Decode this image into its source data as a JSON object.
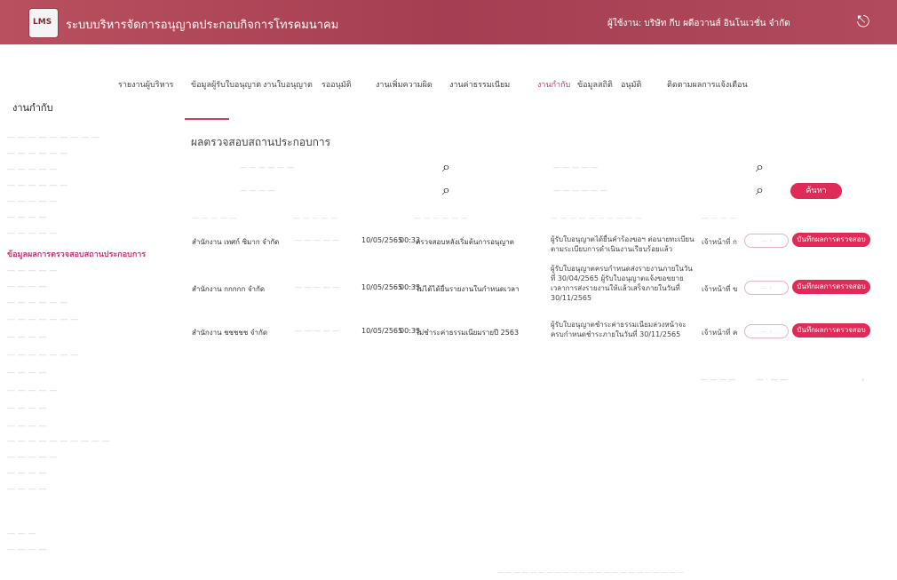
{
  "header": {
    "logo_text": "LMS",
    "app_title": "ระบบบริหารจัดการอนุญาตประกอบกิจการโทรคมนาคม",
    "user": "ผู้ใช้งาน: บริษัท กีบ ผดีอวานส์ อินโนเวชั่น จำกัด",
    "logout_icon": "logout-icon"
  },
  "nav": {
    "items": [
      "รายงานผู้บริหาร",
      "ข้อมูลผู้รับใบอนุญาต",
      "งานใบอนุญาต",
      "รออนุมัติ",
      "งานเพิ่มความผิด",
      "งานค่าธรรมเนียม",
      "งานกำกับ",
      "ข้อมูลสถิติ",
      "อนุมัติ",
      "ติดตามผลการแจ้งเตือน"
    ],
    "active": "งานกำกับ"
  },
  "sidebar": {
    "title": "งานกำกับ",
    "active_item": "ข้อมูลผลการตรวจสอบสถานประกอบการ"
  },
  "main": {
    "page_title": "ผลตรวจสอบสถานประกอบการ",
    "search_button": "ค้นหา",
    "rows": [
      {
        "company": "สำนักงาน เทศก์ ซิมาก จำกัด",
        "date": "10/05/2565",
        "time": "00:33",
        "topic": "ตรวจสอบหลังเริ่มต้นการอนุญาต",
        "notes": "ผู้รับใบอนุญาตได้ยื่นคำร้องขอฯ ต่อนายทะเบียนตามระเบียบการดำเนินงานเรียบร้อยแล้ว",
        "status": "เจ้าหน้าที่ ก",
        "action": "บันทึกผลการตรวจสอบ"
      },
      {
        "company": "สำนักงาน กกกกก จำกัด",
        "date": "10/05/2565",
        "time": "00:33",
        "topic": "ไม่ได้ได้ยื่นรายงานในกำหนดเวลา",
        "notes": "ผู้รับใบอนุญาตครบกำหนดส่งรายงานภายในวันที่ 30/04/2565 ผู้รับใบอนุญาตแจ้งขอขยายเวลาการส่งรายงานให้แล้วเสร็จภายในวันที่ 30/11/2565",
        "status": "เจ้าหน้าที่ ข",
        "action": "บันทึกผลการตรวจสอบ"
      },
      {
        "company": "สำนักงาน ชชชชช จำกัด",
        "date": "10/05/2565",
        "time": "00:33",
        "topic": "ไม่ชำระค่าธรรมเนียมรายปี 2563",
        "notes": "ผู้รับใบอนุญาตชำระค่าธรรมเนียมล่วงหน้าจะครบกำหนดชำระภายในวันที่ 30/11/2565",
        "status": "เจ้าหน้าที่ ค",
        "action": "บันทึกผลการตรวจสอบ"
      }
    ]
  },
  "colors": {
    "header": "#b04a5c",
    "accent": "#e02a57",
    "active_nav": "#c33a77"
  }
}
